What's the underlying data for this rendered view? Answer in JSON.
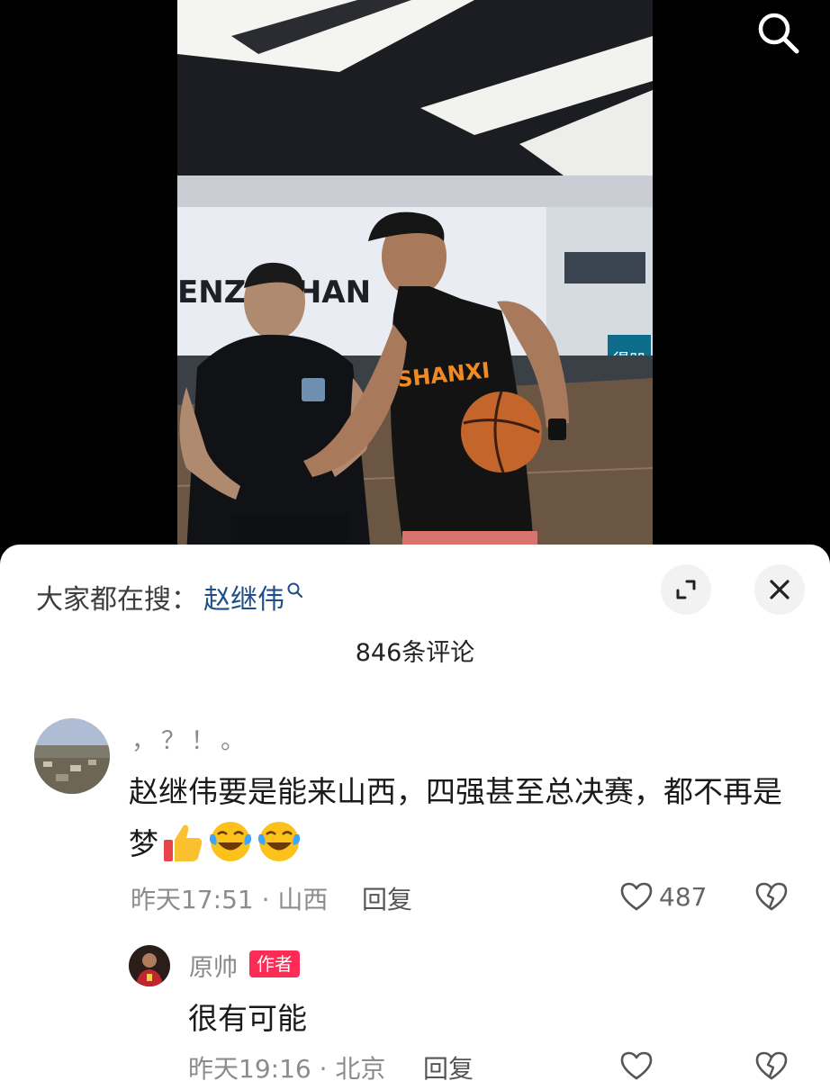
{
  "video": {
    "wall_text": "ENZUGHAN",
    "jersey_text": "SHANXI",
    "sign_text": "得凹"
  },
  "sheet": {
    "hot_search_label": "大家都在搜：",
    "hot_search_keyword": "赵继伟",
    "comment_count": "846条评论"
  },
  "comments": [
    {
      "username": "，？！。",
      "text": "赵继伟要是能来山西，四强甚至总决赛，都不再是梦",
      "emojis": [
        "thumbs-up",
        "laugh-cry",
        "laugh-cry"
      ],
      "time": "昨天17:51",
      "location": "山西",
      "separator": "·",
      "reply_label": "回复",
      "likes": "487"
    },
    {
      "username": "原帅",
      "badge": "作者",
      "text": "很有可能",
      "time": "昨天19:16",
      "location": "北京",
      "separator": "·",
      "reply_label": "回复"
    }
  ],
  "colors": {
    "keyword": "#1f4f86",
    "badge": "#fe2c55",
    "sheet_bg": "#ffffff"
  }
}
